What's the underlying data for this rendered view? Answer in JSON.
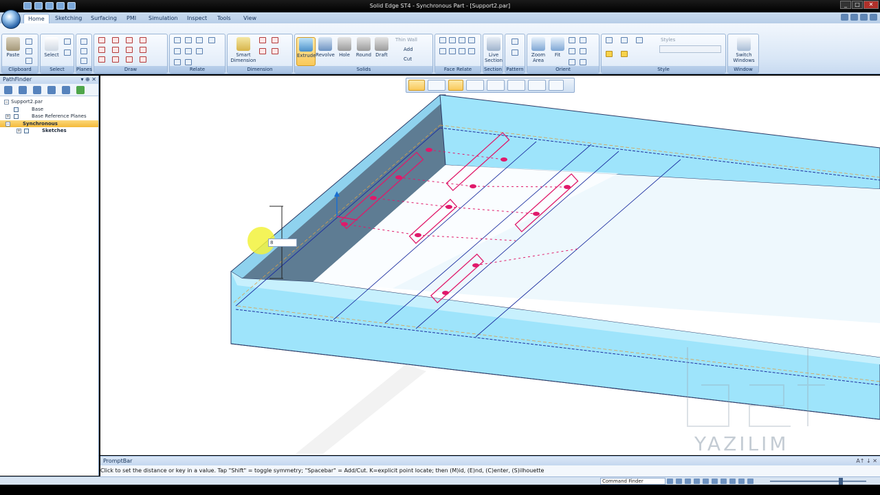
{
  "app": {
    "title": "Solid Edge ST4 - Synchronous Part - [Support2.par]"
  },
  "tabs": [
    "Home",
    "Sketching",
    "Surfacing",
    "PMI",
    "Simulation",
    "Inspect",
    "Tools",
    "View"
  ],
  "active_tab": "Home",
  "ribbon": {
    "groups": [
      {
        "label": "Clipboard",
        "buttons": [
          "Paste"
        ]
      },
      {
        "label": "Select",
        "buttons": [
          "Select"
        ]
      },
      {
        "label": "Planes",
        "buttons": []
      },
      {
        "label": "Draw",
        "buttons": []
      },
      {
        "label": "Relate",
        "buttons": []
      },
      {
        "label": "Dimension",
        "buttons": [
          "Smart Dimension"
        ]
      },
      {
        "label": "Solids",
        "buttons": [
          "Extrude",
          "Revolve",
          "Hole",
          "Round",
          "Draft",
          "Thin Wall",
          "Add",
          "Cut"
        ]
      },
      {
        "label": "Face Relate",
        "buttons": []
      },
      {
        "label": "Section",
        "buttons": [
          "Live Section"
        ]
      },
      {
        "label": "Pattern",
        "buttons": []
      },
      {
        "label": "Orient",
        "buttons": [
          "Zoom Area",
          "Fit"
        ]
      },
      {
        "label": "Style",
        "buttons": [
          "Styles"
        ]
      },
      {
        "label": "Window",
        "buttons": [
          "Switch Windows"
        ]
      }
    ]
  },
  "pathfinder": {
    "title": "PathFinder",
    "items": [
      {
        "label": "Support2.par",
        "level": 0
      },
      {
        "label": "Base",
        "level": 1
      },
      {
        "label": "Base Reference Planes",
        "level": 1
      },
      {
        "label": "Synchronous",
        "level": 1,
        "selected": true
      },
      {
        "label": "Sketches",
        "level": 2
      }
    ]
  },
  "dimension_input": {
    "value": "8"
  },
  "watermark": {
    "text": "YAZILIM"
  },
  "promptbar": {
    "title": "PromptBar",
    "text": "Click to set the distance or key in a value.  Tap \"Shift\" = toggle symmetry; \"Spacebar\" = Add/Cut.  K=explicit point locate; then (M)id, (E)nd, (C)enter, (S)ilhouette",
    "icons": "A↑ ↓ ✕"
  },
  "statusbar": {
    "command_finder": "Command Finder"
  },
  "colors": {
    "part_face": "#9ee4fb",
    "part_edge": "#1c2fa0",
    "sketch": "#e0196a",
    "ribbon": "#d8e6f6"
  }
}
